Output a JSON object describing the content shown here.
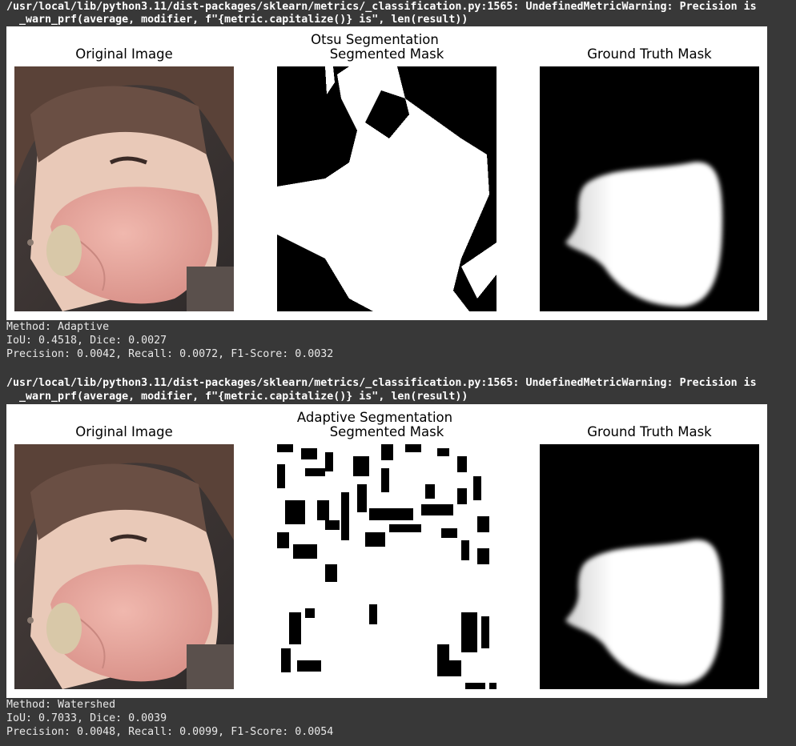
{
  "output": {
    "warning_line1": "/usr/local/lib/python3.11/dist-packages/sklearn/metrics/_classification.py:1565: UndefinedMetricWarning: Precision is",
    "warning_line2": "  _warn_prf(average, modifier, f\"{metric.capitalize()} is\", len(result))"
  },
  "figures": [
    {
      "suptitle": "Otsu Segmentation",
      "panel_titles": [
        "Original Image",
        "Segmented Mask",
        "Ground Truth Mask"
      ]
    },
    {
      "suptitle": "Adaptive Segmentation",
      "panel_titles": [
        "Original Image",
        "Segmented Mask",
        "Ground Truth Mask"
      ]
    }
  ],
  "metrics": [
    {
      "method": "Method: Adaptive",
      "iou_dice": "IoU: 0.4518, Dice: 0.0027",
      "prf": "Precision: 0.0042, Recall: 0.0072, F1-Score: 0.0032"
    },
    {
      "method": "Method: Watershed",
      "iou_dice": "IoU: 0.7033, Dice: 0.0039",
      "prf": "Precision: 0.0048, Recall: 0.0099, F1-Score: 0.0054"
    }
  ],
  "colors": {
    "output_background": "#383838",
    "figure_background": "#ffffff",
    "mask_foreground": "#ffffff",
    "mask_background": "#000000",
    "skin": "#e9c9b8",
    "mask_pink": "#e8a9a0",
    "hair": "#5a4238"
  },
  "icons": {
    "original_image": "face-with-pink-mask-photo",
    "segmented_mask": "binary-mask-image",
    "ground_truth_mask": "ground-truth-mask-image"
  }
}
